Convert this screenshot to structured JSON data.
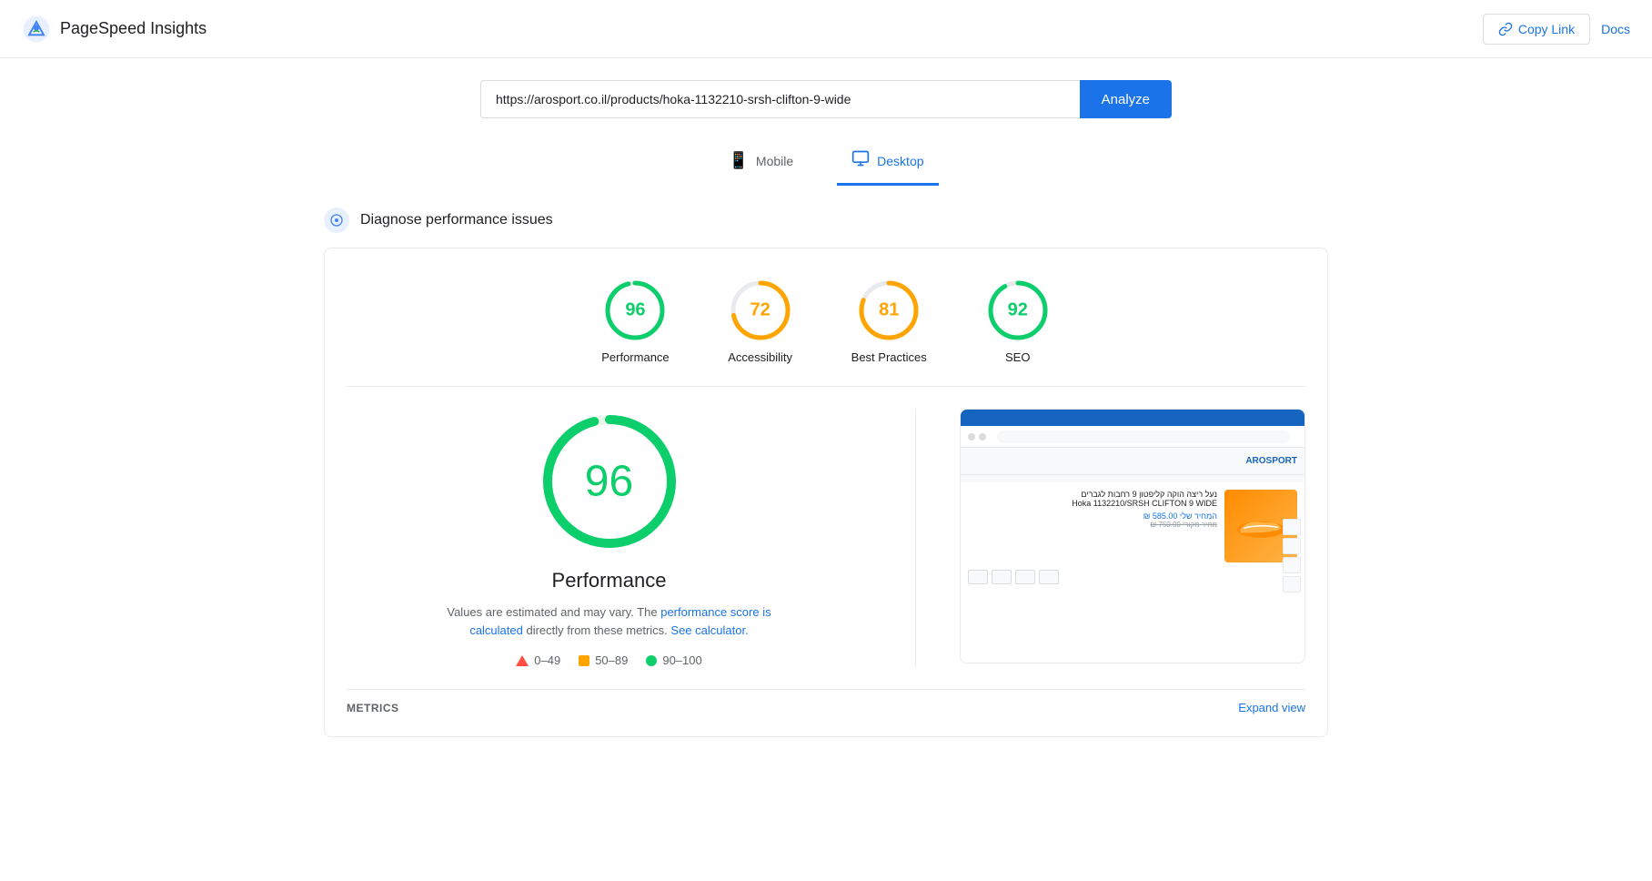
{
  "app": {
    "title": "PageSpeed Insights"
  },
  "header": {
    "copy_link_label": "Copy Link",
    "docs_label": "Docs"
  },
  "url_bar": {
    "url_value": "https://arosport.co.il/products/hoka-1132210-srsh-clifton-9-wide",
    "url_placeholder": "Enter a web page URL",
    "analyze_label": "Analyze"
  },
  "mode_tabs": [
    {
      "id": "mobile",
      "label": "Mobile",
      "icon": "📱",
      "active": false
    },
    {
      "id": "desktop",
      "label": "Desktop",
      "icon": "🖥",
      "active": true
    }
  ],
  "section": {
    "title": "Diagnose performance issues"
  },
  "scores": [
    {
      "id": "performance",
      "value": 96,
      "label": "Performance",
      "color": "green",
      "percent": 96
    },
    {
      "id": "accessibility",
      "value": 72,
      "label": "Accessibility",
      "color": "orange",
      "percent": 72
    },
    {
      "id": "best_practices",
      "value": 81,
      "label": "Best Practices",
      "color": "orange",
      "percent": 81
    },
    {
      "id": "seo",
      "value": 92,
      "label": "SEO",
      "color": "green",
      "percent": 92
    }
  ],
  "performance_detail": {
    "score": "96",
    "title": "Performance",
    "description_static": "Values are estimated and may vary. The",
    "description_link1": "performance score is calculated",
    "description_link1_suffix": "directly from these metrics.",
    "description_link2": "See calculator.",
    "legend": [
      {
        "type": "triangle",
        "range": "0–49"
      },
      {
        "type": "square",
        "range": "50–89"
      },
      {
        "type": "dot",
        "color": "#0cce6b",
        "range": "90–100"
      }
    ]
  },
  "metrics": {
    "label": "METRICS",
    "expand": "Expand view"
  }
}
